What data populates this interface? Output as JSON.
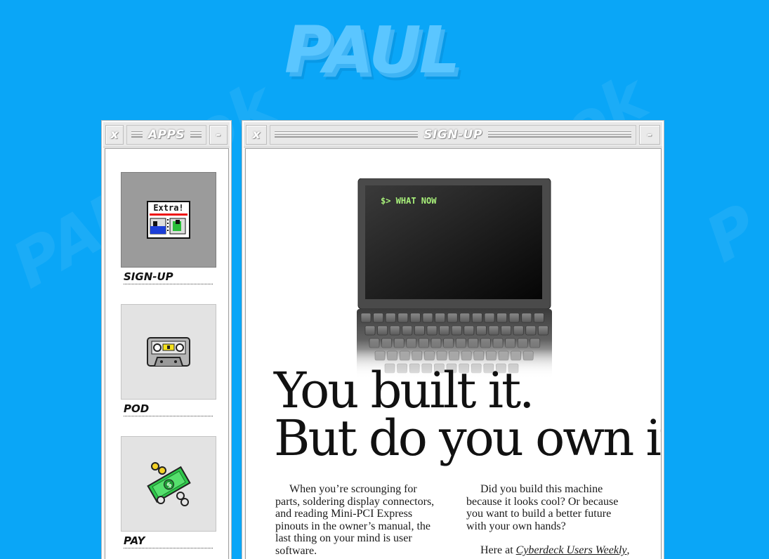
{
  "brand": {
    "logo_text": "PAUL"
  },
  "apps_window": {
    "title": "APPS",
    "close_label": "x",
    "minimize_label": "-",
    "apps": [
      {
        "label": "SIGN-UP",
        "icon": "newspaper-icon",
        "icon_text": "Extra!",
        "active": true
      },
      {
        "label": "POD",
        "icon": "cassette-icon",
        "active": false
      },
      {
        "label": "PAY",
        "icon": "money-icon",
        "active": false
      }
    ]
  },
  "signup_window": {
    "title": "SIGN-UP",
    "close_label": "x",
    "minimize_label": "-",
    "terminal_prompt": "$> WHAT NOW",
    "headline_line1": "You built it.",
    "headline_line2": "But do you own it?",
    "column_left": "When you’re scrounging for parts, soldering display connectors, and reading Mini-PCI Express pinouts in the owner’s manual, the last thing on your mind is user software.",
    "column_right_p1": "Did you build this machine because it looks cool? Or because you want to build a better future with your own hands?",
    "column_right_p2_prefix": "Here at",
    "column_right_p2_link": "Cyberdeck Users Weekly",
    "column_right_p2_suffix": ", we"
  },
  "colors": {
    "background": "#0aa6f7",
    "logo": "#5bc6ff",
    "terminal_text": "#a8f07a",
    "window_chrome": "#e8e8e8"
  }
}
